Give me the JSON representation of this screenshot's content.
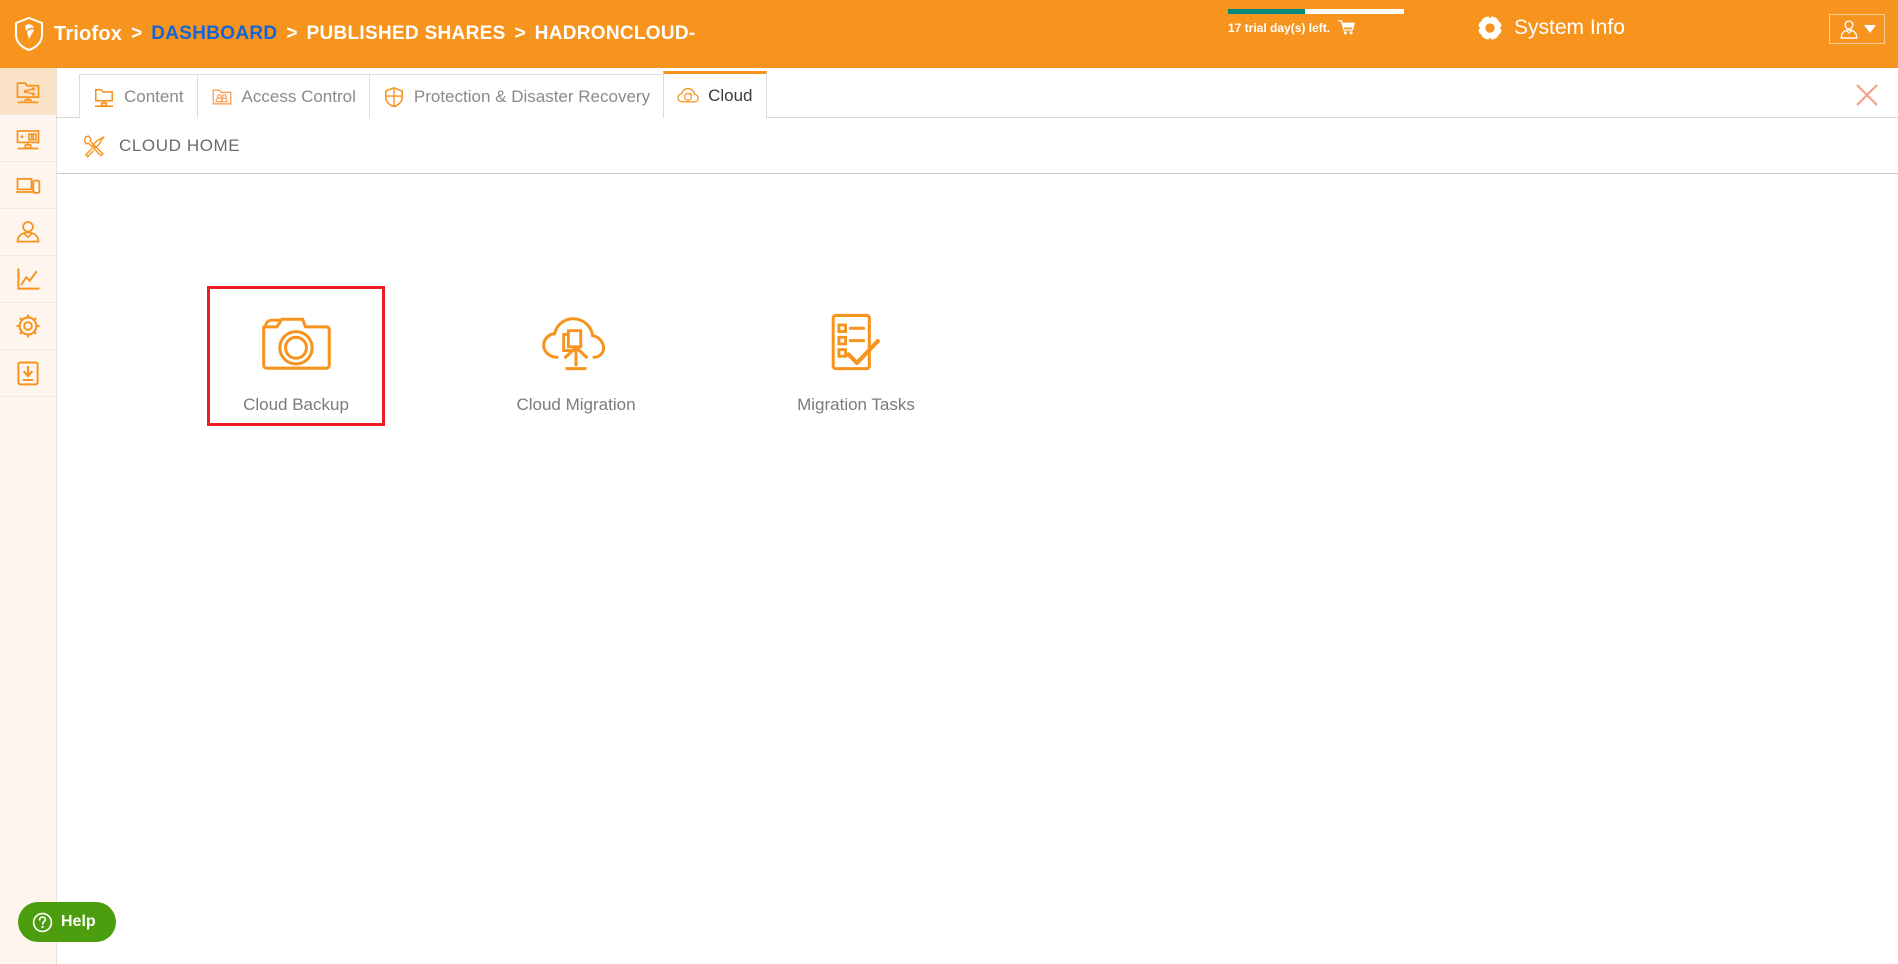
{
  "topbar": {
    "logo_icon": "shield-logo-icon",
    "brand": "Triofox",
    "separator": ">",
    "breadcrumbs": [
      {
        "label": "DASHBOARD",
        "style": "link"
      },
      {
        "label": "PUBLISHED SHARES",
        "style": "plain"
      },
      {
        "label": "HADRONCLOUD-",
        "style": "plain"
      }
    ],
    "trial": {
      "text": "17 trial day(s) left.",
      "cart_icon": "shopping-cart-icon",
      "progress_percent": 44,
      "bar_fill_color": "#00897B",
      "bar_track_color": "#FFFFFF"
    },
    "system_info": {
      "label": "System Info",
      "icon": "gear-icon"
    },
    "user_menu": {
      "icon": "user-icon",
      "caret_icon": "caret-down-icon"
    },
    "background_color": "#F7941E"
  },
  "sidebar": {
    "items": [
      {
        "name": "shared-folders",
        "icon": "shared-folder-network-icon",
        "active": true
      },
      {
        "name": "server-monitor",
        "icon": "server-monitor-icon",
        "active": false
      },
      {
        "name": "devices",
        "icon": "laptop-phone-devices-icon",
        "active": false
      },
      {
        "name": "users",
        "icon": "user-person-icon",
        "active": false
      },
      {
        "name": "reports",
        "icon": "line-chart-icon",
        "active": false
      },
      {
        "name": "settings",
        "icon": "gear-settings-icon",
        "active": false
      },
      {
        "name": "downloads",
        "icon": "download-box-icon",
        "active": false
      }
    ],
    "background_color": "#FDF5EE",
    "active_color": "#FBE3C8"
  },
  "tabs": [
    {
      "label": "Content",
      "icon": "folder-monitor-icon",
      "active": false
    },
    {
      "label": "Access Control",
      "icon": "folder-users-icon",
      "active": false
    },
    {
      "label": "Protection & Disaster Recovery",
      "icon": "shield-icon",
      "active": false
    },
    {
      "label": "Cloud",
      "icon": "cloud-sync-icon",
      "active": true
    }
  ],
  "close_tab_icon": "close-x-icon",
  "page_header": {
    "icon": "tools-wrench-screwdriver-icon",
    "title": "CLOUD HOME"
  },
  "cards": [
    {
      "label": "Cloud Backup",
      "icon": "camera-icon",
      "highlighted": true
    },
    {
      "label": "Cloud Migration",
      "icon": "cloud-upload-documents-icon",
      "highlighted": false
    },
    {
      "label": "Migration Tasks",
      "icon": "checklist-clipboard-icon",
      "highlighted": false
    }
  ],
  "help_widget": {
    "label": "Help",
    "icon": "question-circle-icon",
    "color": "#4C9E0E"
  },
  "theme": {
    "accent": "#F7941E",
    "highlight_red": "#EE1C25",
    "link_blue": "#1565D8",
    "text_gray": "#7B7B7B"
  }
}
